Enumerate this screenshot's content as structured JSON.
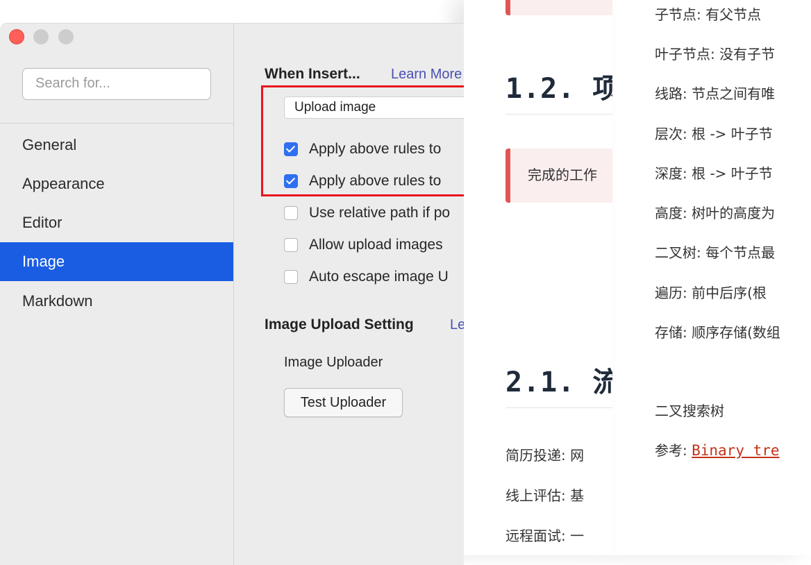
{
  "doc_right": {
    "lines": [
      "子节点: 有父节点",
      "叶子节点: 没有子节",
      "线路: 节点之间有唯",
      "层次: 根 -> 叶子节",
      "深度: 根 -> 叶子节",
      "高度: 树叶的高度为",
      "二叉树: 每个节点最",
      "遍历: 前中后序(根",
      "存储: 顺序存储(数组",
      "二叉搜索树"
    ],
    "ref_label": "参考: ",
    "ref_link": "Binary tre"
  },
  "doc_mid": {
    "heading_1": "1.2. 项",
    "quote": "完成的工作",
    "heading_2": "2.1. 流",
    "lines": [
      "简历投递: 网",
      "线上评估: 基",
      "远程面试: 一"
    ]
  },
  "prefs": {
    "search_placeholder": "Search for...",
    "nav": [
      "General",
      "Appearance",
      "Editor",
      "Image",
      "Markdown"
    ],
    "active_nav": "Image",
    "when_insert_title": "When Insert...",
    "learn_more": "Learn More",
    "select_value": "Upload image",
    "checks": [
      {
        "label": "Apply above rules to",
        "checked": true
      },
      {
        "label": "Apply above rules to",
        "checked": true
      },
      {
        "label": "Use relative path if po",
        "checked": false
      },
      {
        "label": "Allow upload images",
        "checked": false
      },
      {
        "label": "Auto escape image U",
        "checked": false
      }
    ],
    "upload_title": "Image Upload Setting",
    "upload_learn": "Le",
    "uploader_label": "Image Uploader",
    "test_button": "Test Uploader"
  },
  "colors": {
    "accent": "#1a5de2",
    "checkbox": "#2f6ff0",
    "highlight": "#e8141c",
    "quote_border": "#e05555",
    "link": "#c4311a"
  }
}
